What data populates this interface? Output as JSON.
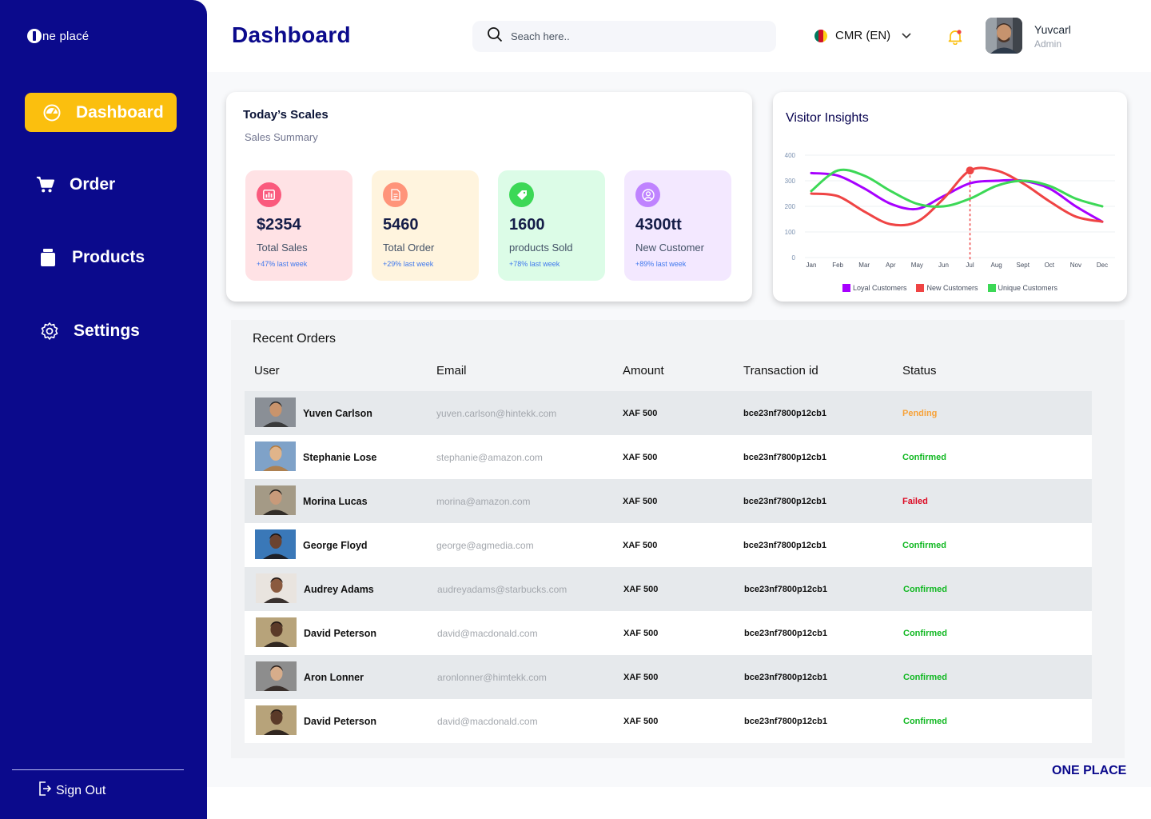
{
  "sidebar": {
    "logo_text": "ne placé",
    "items": [
      {
        "label": "Dashboard",
        "icon": "gauge-icon",
        "active": true
      },
      {
        "label": "Order",
        "icon": "cart-icon",
        "active": false
      },
      {
        "label": "Products",
        "icon": "box-icon",
        "active": false
      },
      {
        "label": "Settings",
        "icon": "gear-icon",
        "active": false
      }
    ],
    "signout_label": "Sign Out"
  },
  "header": {
    "title": "Dashboard",
    "search_placeholder": "Seach here..",
    "language": "CMR (EN)",
    "user_name": "Yuvcarl",
    "user_role": "Admin"
  },
  "sales": {
    "title": "Today’s Scales",
    "subtitle": "Sales Summary",
    "stats": [
      {
        "value": "$2354",
        "label": "Total Sales",
        "note": "+47% last week",
        "bg": "#ffe2e5",
        "icon_bg": "#fa5a7d",
        "icon": "bar-chart-icon"
      },
      {
        "value": "5460",
        "label": "Total Order",
        "note": "+29% last week",
        "bg": "#fff4de",
        "icon_bg": "#ff947a",
        "icon": "document-icon"
      },
      {
        "value": "1600",
        "label": "products Sold",
        "note": "+78% last week",
        "bg": "#dcfce7",
        "icon_bg": "#3cd856",
        "icon": "tag-icon"
      },
      {
        "value": "4300tt",
        "label": "New Customer",
        "note": "+89% last week",
        "bg": "#f3e8ff",
        "icon_bg": "#bf83ff",
        "icon": "user-icon"
      }
    ]
  },
  "visitor": {
    "title": "Visitor Insights"
  },
  "chart_data": {
    "type": "line",
    "title": "Visitor Insights",
    "categories": [
      "Jan",
      "Feb",
      "Mar",
      "Apr",
      "May",
      "Jun",
      "Jul",
      "Aug",
      "Sept",
      "Oct",
      "Nov",
      "Dec"
    ],
    "ylim": [
      0,
      400
    ],
    "yticks": [
      "400",
      "300",
      "200",
      "100",
      "0"
    ],
    "grid": true,
    "legend_position": "bottom",
    "series": [
      {
        "name": "Loyal Customers",
        "color": "#a700ff",
        "values": [
          330,
          320,
          270,
          210,
          190,
          240,
          290,
          300,
          300,
          270,
          200,
          140
        ]
      },
      {
        "name": "New Customers",
        "color": "#ef4444",
        "values": [
          250,
          240,
          180,
          130,
          140,
          230,
          340,
          340,
          290,
          220,
          160,
          140
        ]
      },
      {
        "name": "Unique Customers",
        "color": "#3cd856",
        "values": [
          260,
          340,
          320,
          260,
          210,
          200,
          230,
          280,
          300,
          280,
          230,
          200
        ]
      }
    ]
  },
  "orders": {
    "title": "Recent Orders",
    "columns": [
      "User",
      "Email",
      "Amount",
      "Transaction id",
      "Status"
    ],
    "rows": [
      {
        "user": "Yuven Carlson",
        "email": "yuven.carlson@hintekk.com",
        "amount": "XAF 500",
        "tx": "bce23nf7800p12cb1",
        "status": "Pending",
        "status_kind": "pending"
      },
      {
        "user": "Stephanie Lose",
        "email": "stephanie@amazon.com",
        "amount": "XAF 500",
        "tx": "bce23nf7800p12cb1",
        "status": "Confirmed",
        "status_kind": "confirmed"
      },
      {
        "user": "Morina Lucas",
        "email": "morina@amazon.com",
        "amount": "XAF 500",
        "tx": "bce23nf7800p12cb1",
        "status": "Failed",
        "status_kind": "failed"
      },
      {
        "user": "George Floyd",
        "email": "george@agmedia.com",
        "amount": "XAF 500",
        "tx": "bce23nf7800p12cb1",
        "status": "Confirmed",
        "status_kind": "confirmed"
      },
      {
        "user": "Audrey Adams",
        "email": "audreyadams@starbucks.com",
        "amount": "XAF 500",
        "tx": "bce23nf7800p12cb1",
        "status": "Confirmed",
        "status_kind": "confirmed"
      },
      {
        "user": "David Peterson",
        "email": "david@macdonald.com",
        "amount": "XAF 500",
        "tx": "bce23nf7800p12cb1",
        "status": "Confirmed",
        "status_kind": "confirmed"
      },
      {
        "user": "Aron Lonner",
        "email": "aronlonner@himtekk.com",
        "amount": "XAF 500",
        "tx": "bce23nf7800p12cb1",
        "status": "Confirmed",
        "status_kind": "confirmed"
      },
      {
        "user": "David Peterson",
        "email": "david@macdonald.com",
        "amount": "XAF 500",
        "tx": "bce23nf7800p12cb1",
        "status": "Confirmed",
        "status_kind": "confirmed"
      }
    ]
  },
  "footer": {
    "brand": "ONE PLACE"
  },
  "colors": {
    "primary": "#0b0a8c",
    "accent": "#fbbf0e"
  }
}
